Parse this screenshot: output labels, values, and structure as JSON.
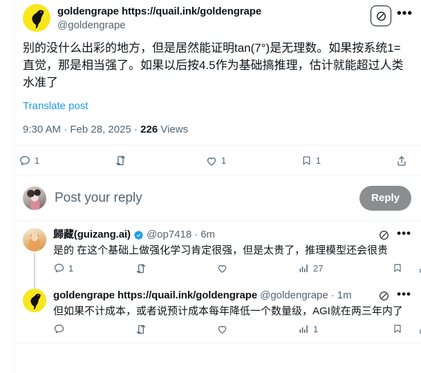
{
  "main_post": {
    "display_name": "goldengrape https://quail.ink/goldengrape",
    "handle": "@goldengrape",
    "avatar_icon": "bird-avatar",
    "grok_icon": "grok-icon",
    "more_icon": "more-options-icon",
    "body": "别的没什么出彩的地方，但是居然能证明tan(7°)是无理数。如果按系统1=直觉，那是相当强了。如果以后按4.5作为基础搞推理，估计就能超过人类水准了",
    "translate_label": "Translate post",
    "time": "9:30 AM",
    "date": "Feb 28, 2025",
    "views_count": "226",
    "views_label": "Views",
    "separator_dot": "·",
    "actions": {
      "reply": {
        "icon": "comment-icon",
        "count": "1"
      },
      "retweet": {
        "icon": "retweet-icon",
        "count": ""
      },
      "like": {
        "icon": "heart-icon",
        "count": "1"
      },
      "bookmark": {
        "icon": "bookmark-icon",
        "count": "1"
      },
      "share": {
        "icon": "share-icon",
        "count": ""
      }
    }
  },
  "composer": {
    "avatar_icon": "calico-cat-avatar",
    "placeholder": "Post your reply",
    "reply_button_label": "Reply"
  },
  "replies": [
    {
      "avatar_icon": "orange-cat-avatar",
      "display_name": "歸藏(guizang.ai)",
      "verified": true,
      "verified_icon": "verified-badge-icon",
      "handle": "@op7418",
      "dot": "·",
      "age": "6m",
      "grok_icon": "grok-icon",
      "more_icon": "more-options-icon",
      "body": "是的 在这个基础上做强化学习肯定很强，但是太贵了，推理模型还会很贵",
      "actions": {
        "reply": {
          "icon": "comment-icon",
          "count": "1"
        },
        "retweet": {
          "icon": "retweet-icon",
          "count": ""
        },
        "like": {
          "icon": "heart-icon",
          "count": ""
        },
        "views": {
          "icon": "views-icon",
          "count": "27"
        },
        "bookmark": {
          "icon": "bookmark-icon",
          "count": ""
        },
        "share": {
          "icon": "share-icon",
          "count": ""
        }
      }
    },
    {
      "avatar_icon": "bird-avatar",
      "display_name": "goldengrape https://quail.ink/goldengrape",
      "verified": false,
      "handle": "@goldengrape",
      "dot": "·",
      "age": "1m",
      "grok_icon": "grok-icon",
      "more_icon": "more-options-icon",
      "body": "但如果不计成本，或者说预计成本每年降低一个数量级，AGI就在两三年内了",
      "actions": {
        "reply": {
          "icon": "comment-icon",
          "count": ""
        },
        "retweet": {
          "icon": "retweet-icon",
          "count": ""
        },
        "like": {
          "icon": "heart-icon",
          "count": ""
        },
        "views": {
          "icon": "views-icon",
          "count": "1"
        },
        "bookmark": {
          "icon": "bookmark-icon",
          "count": ""
        },
        "share": {
          "icon": "share-icon",
          "count": ""
        }
      }
    }
  ],
  "colors": {
    "accent_link": "#1d9bf0",
    "text_primary": "#0f1419",
    "text_secondary": "#536471",
    "border": "#eff3f4",
    "avatar_yellow": "#f8e71c",
    "reply_button_bg": "#8b8e91"
  }
}
